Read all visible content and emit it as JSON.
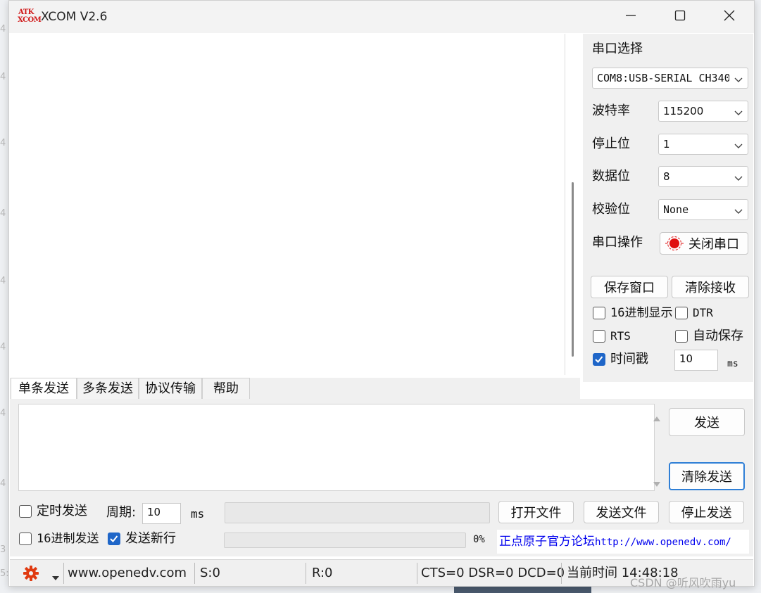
{
  "window": {
    "title": "XCOM V2.6",
    "logo_top": "ATK",
    "logo_bottom": "XCOM"
  },
  "backdrop": {
    "gutter": [
      "4",
      "4",
      "4",
      "4",
      "4",
      "4",
      "4",
      "4",
      "3",
      "5:"
    ]
  },
  "serial": {
    "port_label": "串口选择",
    "port_value": "COM8:USB-SERIAL CH340",
    "baud_label": "波特率",
    "baud_value": "115200",
    "stop_label": "停止位",
    "stop_value": "1",
    "data_label": "数据位",
    "data_value": "8",
    "parity_label": "校验位",
    "parity_value": "None",
    "op_label": "串口操作",
    "close_button": "关闭串口",
    "status_color": "#e01010"
  },
  "receive": {
    "save_window": "保存窗口",
    "clear_recv": "清除接收",
    "hex_display": "16进制显示",
    "hex_display_checked": false,
    "dtr": "DTR",
    "dtr_checked": false,
    "rts": "RTS",
    "rts_checked": false,
    "auto_save": "自动保存",
    "auto_save_checked": false,
    "timestamp": "时间戳",
    "timestamp_checked": true,
    "timestamp_value": "10",
    "timestamp_unit": "ms"
  },
  "tabs": [
    "单条发送",
    "多条发送",
    "协议传输",
    "帮助"
  ],
  "send": {
    "send_button": "发送",
    "clear_send": "清除发送",
    "timed_send": "定时发送",
    "timed_send_checked": false,
    "period_label": "周期:",
    "period_value": "10",
    "period_unit": "ms",
    "open_file": "打开文件",
    "send_file": "发送文件",
    "stop_send": "停止发送",
    "hex_send": "16进制发送",
    "hex_send_checked": false,
    "newline": "发送新行",
    "newline_checked": true,
    "progress_text": "0%",
    "progress": 0,
    "forum_text": "正点原子官方论坛",
    "forum_url": "http://www.openedv.com/"
  },
  "status": {
    "website": "www.openedv.com",
    "sent": "S:0",
    "recv": "R:0",
    "lines": "CTS=0 DSR=0 DCD=0",
    "time": "当前时间 14:48:18"
  },
  "watermark": "CSDN @听风吹雨yu",
  "colors": {
    "accent": "#1f66c8",
    "link": "#0000ee",
    "window_bg": "#f0f0f0"
  }
}
